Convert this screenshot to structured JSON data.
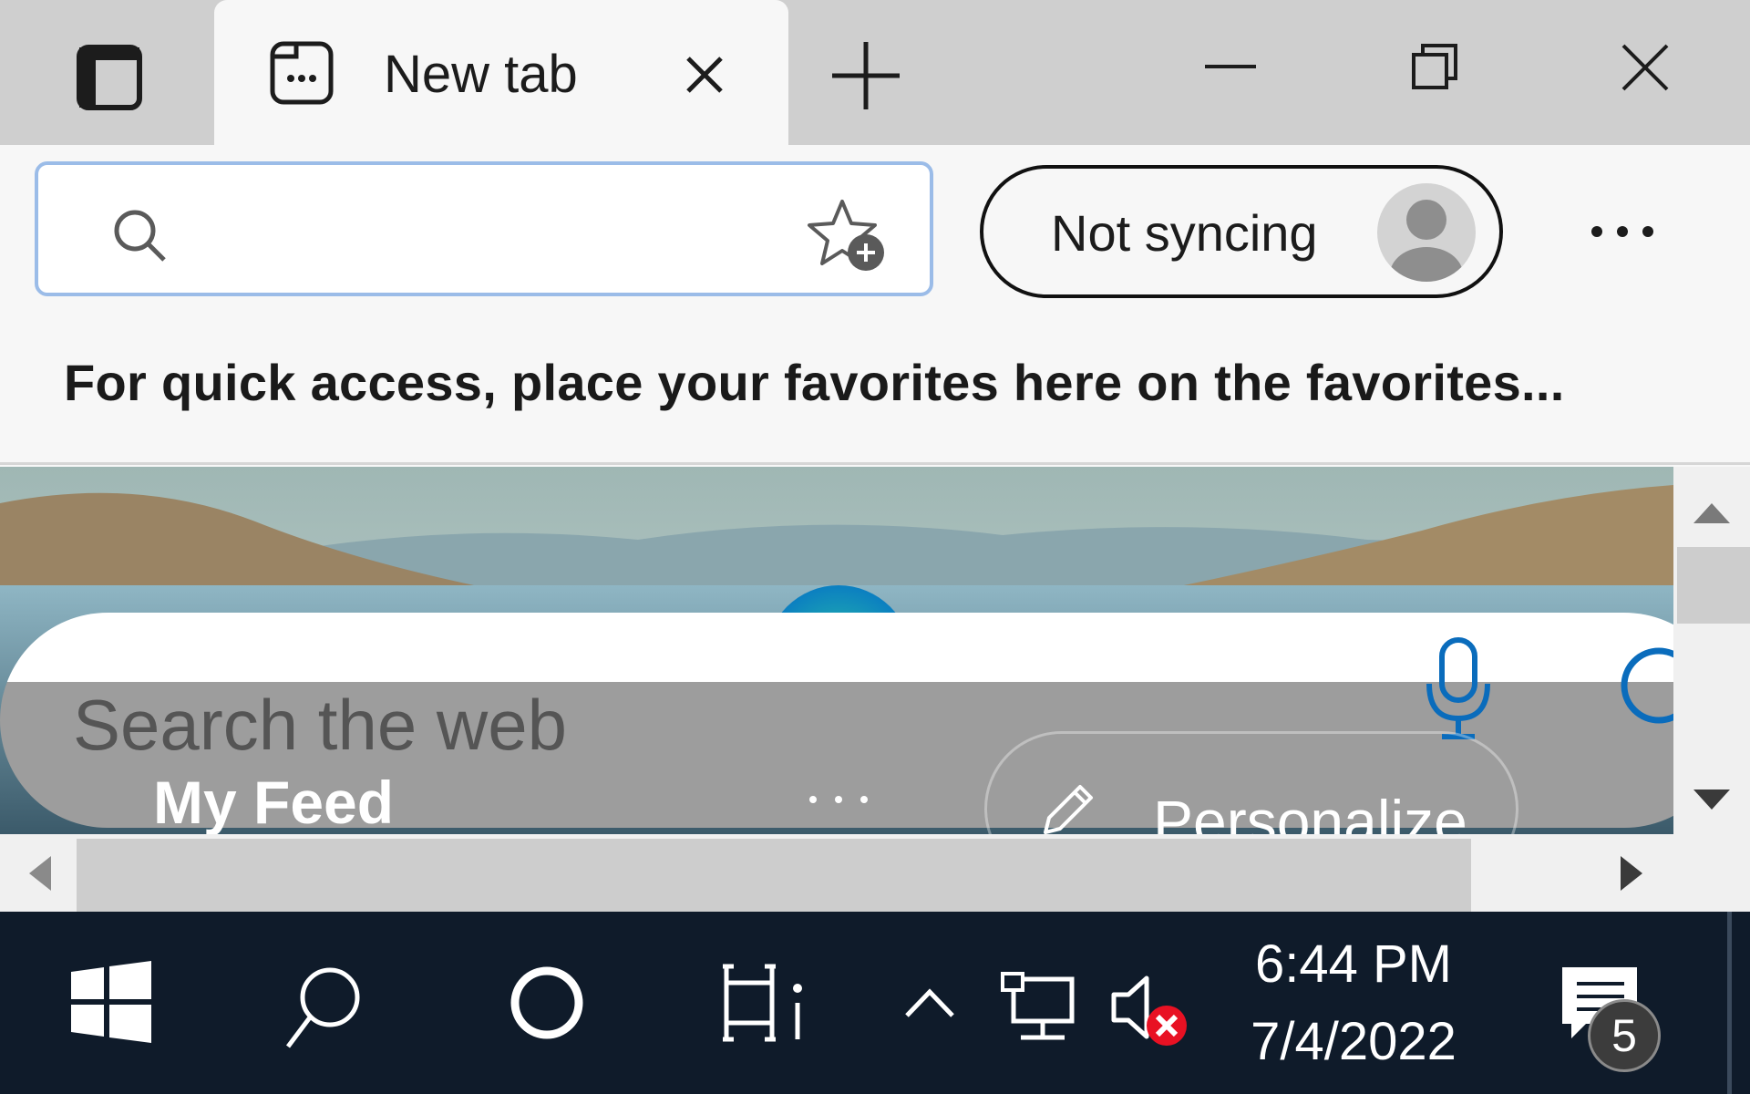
{
  "tab": {
    "title": "New tab"
  },
  "address_bar": {
    "value": "",
    "placeholder": ""
  },
  "profile": {
    "status": "Not syncing"
  },
  "favorites_bar": {
    "hint": "For quick access, place your favorites here on the favorites..."
  },
  "new_tab_page": {
    "search_placeholder": "Search the web",
    "feed_title": "My Feed",
    "personalize_label": "Personalize"
  },
  "taskbar": {
    "time": "6:44 PM",
    "date": "7/4/2022",
    "notification_count": "5"
  },
  "icons": {
    "sidebar": "tab-actions-icon",
    "favicon": "new-tab-icon",
    "search": "search-icon",
    "favorite": "add-favorite-icon",
    "mic": "microphone-icon",
    "start": "windows-logo-icon",
    "volume": "volume-muted-icon"
  },
  "colors": {
    "accent": "#0a6cbc",
    "address_border": "#9bbce8",
    "taskbar": "#0f1b2a",
    "mute_badge": "#e81123"
  }
}
